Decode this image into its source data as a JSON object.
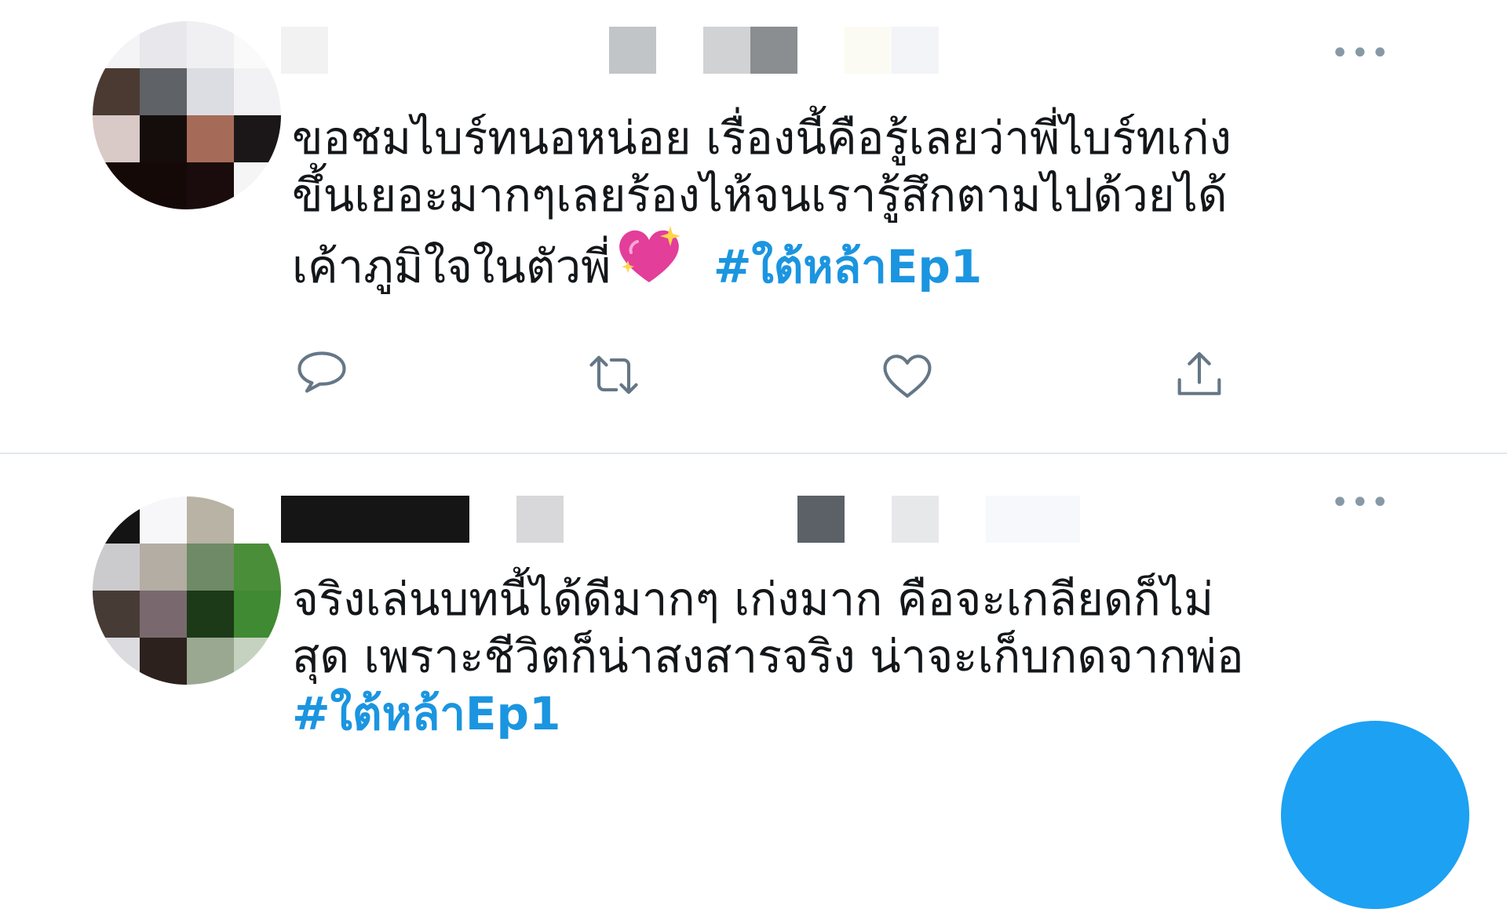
{
  "tweets": [
    {
      "text_lines": [
        "ขอชมไบร์ทนอหน่อย เรื่องนี้คือรู้เลยว่าพี่ไบร์ทเก่ง",
        "ขึ้นเยอะมากๆเลยร้องไห้จนเรารู้สึกตามไปด้วยได้",
        "เค้าภูมิใจในตัวพี่"
      ],
      "hashtag": "#ใต้หล้าEp1",
      "more_icon": "more-horizontal-icon"
    },
    {
      "text_lines": [
        "จริงเล่นบทนี้ได้ดีมากๆ เก่งมาก คือจะเกลียดก็ไม่",
        "สุด เพราะชีวิตก็น่าสงสารจริง น่าจะเก็บกดจากพ่อ"
      ],
      "hashtag": "#ใต้หล้าEp1",
      "more_icon": "more-horizontal-icon"
    }
  ],
  "more_label": "•••",
  "actions": [
    "reply-icon",
    "retweet-icon",
    "like-icon",
    "share-icon"
  ],
  "colors": {
    "hashtag": "#1b95e0",
    "icon": "#657786",
    "divider": "#e1e8ed",
    "fab": "#1da1f2",
    "text": "#14171a"
  }
}
